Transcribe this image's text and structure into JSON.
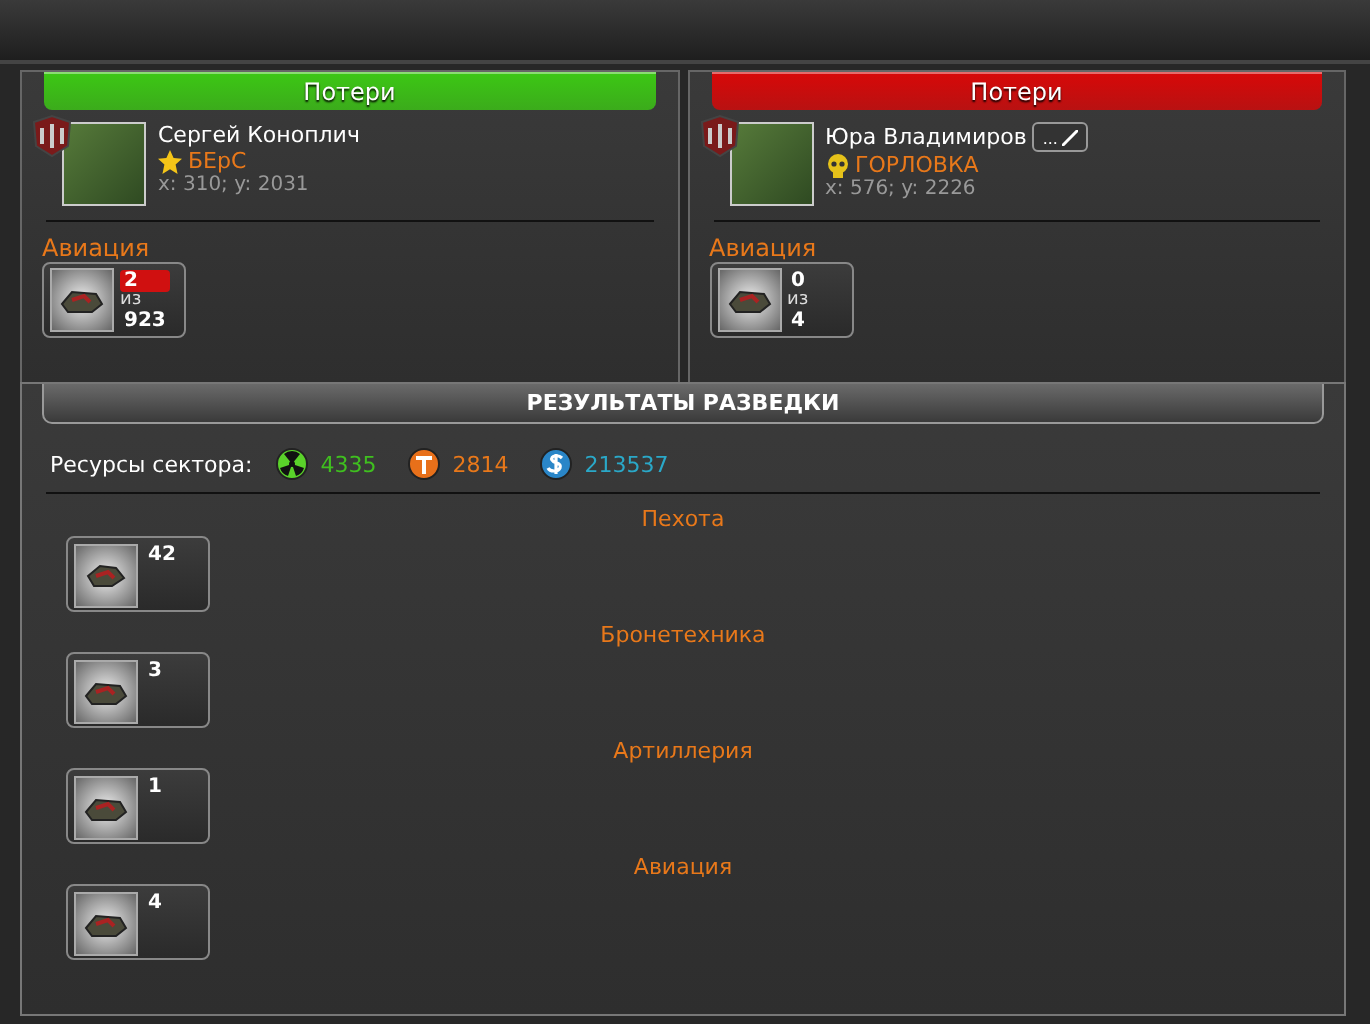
{
  "players": [
    {
      "header": "Потери",
      "color": "#3cc814",
      "name": "Сергей Коноплич",
      "kind": "star",
      "has_edit": false,
      "clan": "БЕрС",
      "coords": "x: 310; y: 2031",
      "category": "Авиация",
      "unit": {
        "lost": "2",
        "of": "из",
        "total": "923",
        "alert": true
      }
    },
    {
      "header": "Потери",
      "color": "#d80808",
      "name": "Юра Владимиров",
      "kind": "skull",
      "has_edit": true,
      "edit_label": "...",
      "clan": "ГОРЛОВКА",
      "coords": "x: 576; y: 2226",
      "category": "Авиация",
      "unit": {
        "lost": "0",
        "of": "из",
        "total": "4",
        "alert": false
      }
    }
  ],
  "report": {
    "title": "РЕЗУЛЬТАТЫ РАЗВЕДКИ",
    "resources_label": "Ресурсы сектора:",
    "resources": [
      {
        "kind": "radiation",
        "value": "4335",
        "color": "#3fbf1f"
      },
      {
        "kind": "titanium",
        "value": "2814",
        "color": "#e8781a"
      },
      {
        "kind": "money",
        "value": "213537",
        "color": "#2aa8c8"
      }
    ],
    "categories": [
      {
        "name": "Пехота",
        "count": "42"
      },
      {
        "name": "Бронетехника",
        "count": "3"
      },
      {
        "name": "Артиллерия",
        "count": "1"
      },
      {
        "name": "Авиация",
        "count": "4"
      }
    ]
  }
}
